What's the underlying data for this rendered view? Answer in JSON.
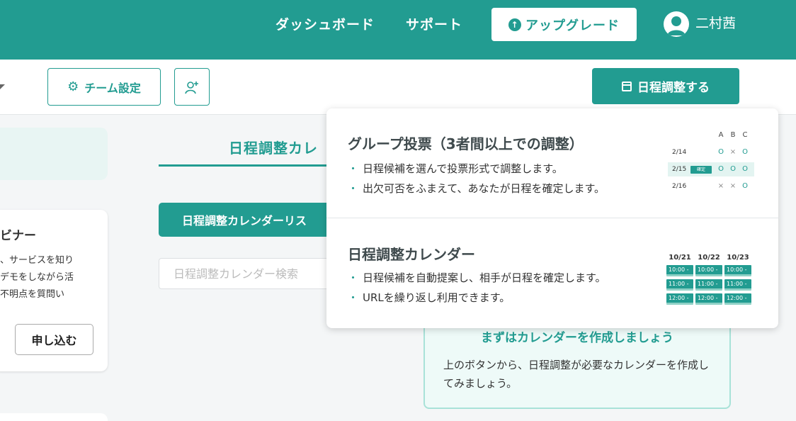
{
  "header": {
    "nav": [
      "ダッシュボード",
      "サポート"
    ],
    "upgrade_label": "アップグレード",
    "user_name": "二村茜"
  },
  "toolbar": {
    "team_settings_label": "チーム設定",
    "schedule_button_label": "日程調整する"
  },
  "sidebar": {
    "webinar_title": "ビナー",
    "webinar_lines": [
      "、サービスを知り",
      "デモをしながら活",
      "不明点を質問い"
    ],
    "apply_label": "申し込む"
  },
  "main": {
    "tab_title": "日程調整カレ",
    "list_button_label": "日程調整カレンダーリス",
    "search_placeholder": "日程調整カレンダー検索",
    "empty_title": "まずはカレンダーを作成しましょう",
    "empty_text": "上のボタンから、日程調整が必要なカレンダーを作成してみましょう。"
  },
  "dropdown": {
    "options": [
      {
        "title": "グループ投票（3者間以上での調整）",
        "bullets": [
          "日程候補を選んで投票形式で調整します。",
          "出欠可否をふまえて、あなたが日程を確定します。"
        ]
      },
      {
        "title": "日程調整カレンダー",
        "bullets": [
          "日程候補を自動提案し、相手が日程を確定します。",
          "URLを繰り返し利用できます。"
        ]
      }
    ],
    "vote_preview": {
      "columns": [
        "A",
        "B",
        "C"
      ],
      "rows": [
        {
          "date": "2/14",
          "marks": [
            "O",
            "×",
            "O"
          ]
        },
        {
          "date": "2/15",
          "marks": [
            "O",
            "O",
            "O"
          ],
          "confirm_label": "確定"
        },
        {
          "date": "2/16",
          "marks": [
            "×",
            "×",
            "O"
          ]
        }
      ]
    },
    "calendar_preview": {
      "days": [
        "10/21",
        "10/22",
        "10/23"
      ],
      "slots": [
        "10:00 -",
        "11:00 -",
        "12:00 -"
      ]
    }
  },
  "colors": {
    "brand": "#229c91",
    "brand_light": "#eefaf8",
    "border_light": "#a8e2d8"
  }
}
